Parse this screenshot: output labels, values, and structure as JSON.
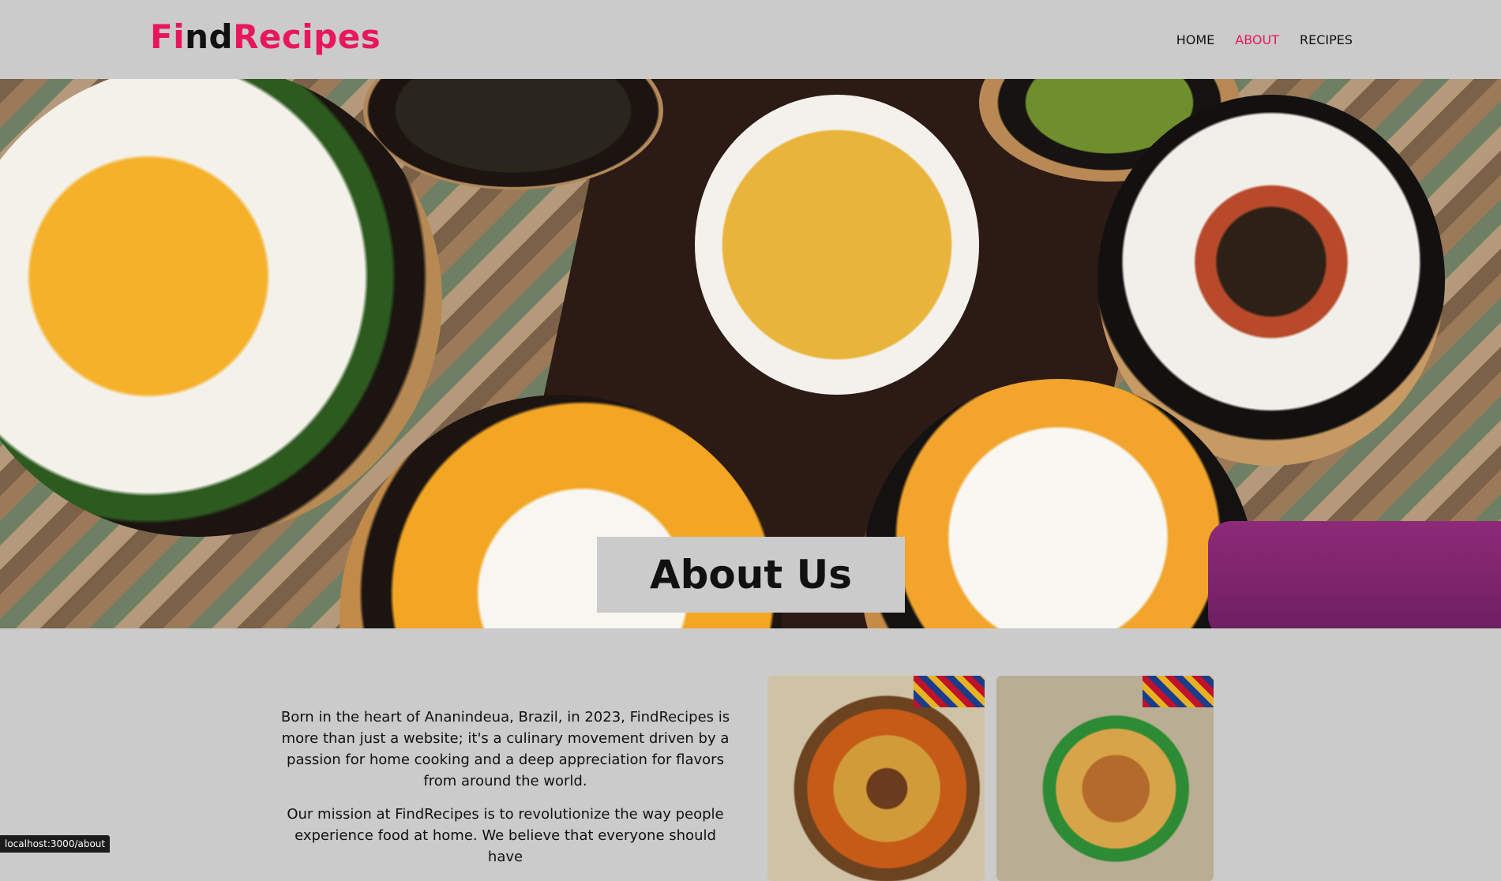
{
  "header": {
    "logo": {
      "part1": "Fi",
      "part2": "nd",
      "part3": "Recipes"
    },
    "nav": [
      {
        "label": "HOME"
      },
      {
        "label": "ABOUT"
      },
      {
        "label": "RECIPES"
      }
    ],
    "active_nav": "ABOUT"
  },
  "hero": {
    "title": "About Us"
  },
  "content": {
    "paragraphs": [
      "Born in the heart of Ananindeua, Brazil, in 2023, FindRecipes is more than just a website; it's a culinary movement driven by a passion for home cooking and a deep appreciation for flavors from around the world.",
      "Our mission at FindRecipes is to revolutionize the way people experience food at home. We believe that everyone should have"
    ]
  },
  "status_bar": {
    "url": "localhost:3000/about"
  },
  "colors": {
    "accent": "#e8175d",
    "background": "#cbcbcb",
    "text": "#111111"
  }
}
